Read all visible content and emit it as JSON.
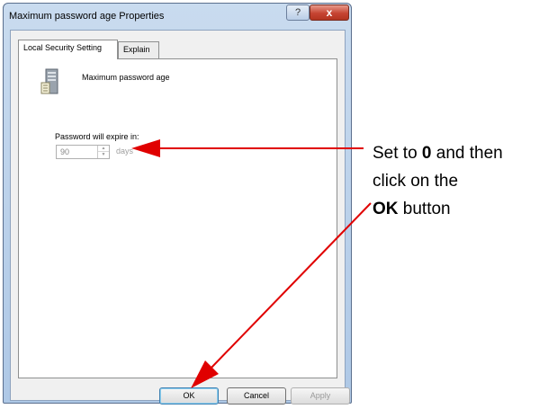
{
  "window": {
    "title": "Maximum password age Properties",
    "help_label": "?",
    "close_label": "x"
  },
  "tabs": [
    {
      "label": "Local Security Setting",
      "active": true
    },
    {
      "label": "Explain",
      "active": false
    }
  ],
  "policy": {
    "name": "Maximum password age",
    "icon": "server-policy-icon"
  },
  "setting": {
    "label": "Password will expire in:",
    "value": "90",
    "unit": "days"
  },
  "buttons": {
    "ok": "OK",
    "cancel": "Cancel",
    "apply": "Apply"
  },
  "annotation": {
    "prefix": "Set to ",
    "value": "0",
    "middle": " and then",
    "line2": "click on the",
    "button_word": "OK",
    "suffix": " button",
    "arrow_color": "#e00000"
  }
}
